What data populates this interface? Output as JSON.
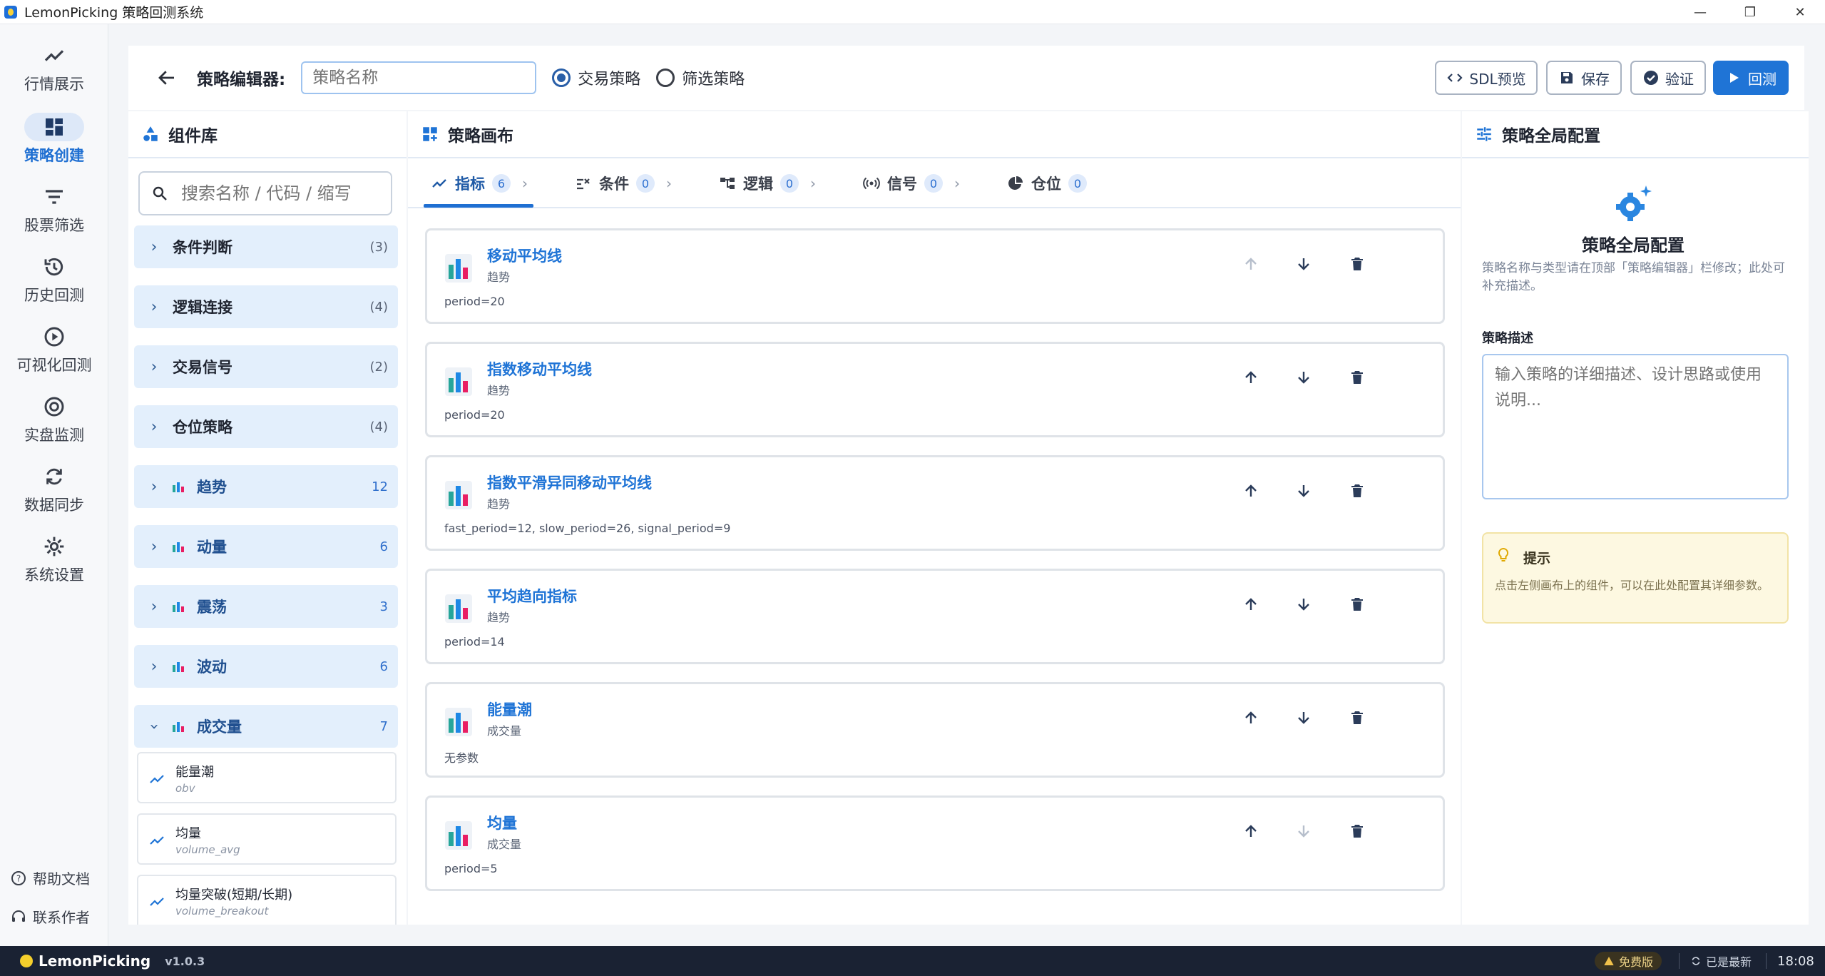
{
  "window": {
    "title": "LemonPicking 策略回测系统",
    "minimize": "—",
    "maximize": "❐",
    "close": "✕"
  },
  "nav": {
    "items": [
      {
        "label": "行情展示",
        "icon": "trend-icon"
      },
      {
        "label": "策略创建",
        "icon": "dashboard-icon",
        "active": true
      },
      {
        "label": "股票筛选",
        "icon": "filter-icon"
      },
      {
        "label": "历史回测",
        "icon": "history-icon"
      },
      {
        "label": "可视化回测",
        "icon": "play-circle-icon"
      },
      {
        "label": "实盘监测",
        "icon": "at-icon"
      },
      {
        "label": "数据同步",
        "icon": "sync-icon"
      },
      {
        "label": "系统设置",
        "icon": "gear-icon"
      }
    ],
    "help": "帮助文档",
    "contact": "联系作者"
  },
  "header": {
    "editor_label": "策略编辑器:",
    "name_placeholder": "策略名称",
    "radio_trade": "交易策略",
    "radio_filter": "筛选策略",
    "btn_sdl": "SDL预览",
    "btn_save": "保存",
    "btn_verify": "验证",
    "btn_backtest": "回测"
  },
  "library": {
    "title": "组件库",
    "search_placeholder": "搜索名称 / 代码 / 缩写",
    "categories": [
      {
        "name": "条件判断",
        "count": "(3)"
      },
      {
        "name": "逻辑连接",
        "count": "(4)"
      },
      {
        "name": "交易信号",
        "count": "(2)"
      },
      {
        "name": "仓位策略",
        "count": "(4)"
      },
      {
        "name": "趋势",
        "count": "12"
      },
      {
        "name": "动量",
        "count": "6"
      },
      {
        "name": "震荡",
        "count": "3"
      },
      {
        "name": "波动",
        "count": "6"
      },
      {
        "name": "成交量",
        "count": "7"
      }
    ],
    "sub_items": [
      {
        "name": "能量潮",
        "code": "obv"
      },
      {
        "name": "均量",
        "code": "volume_avg"
      },
      {
        "name": "均量突破(短期/长期)",
        "code": "volume_breakout"
      }
    ]
  },
  "canvas": {
    "title": "策略画布",
    "tabs": [
      {
        "label": "指标",
        "count": "6"
      },
      {
        "label": "条件",
        "count": "0"
      },
      {
        "label": "逻辑",
        "count": "0"
      },
      {
        "label": "信号",
        "count": "0"
      },
      {
        "label": "仓位",
        "count": "0"
      }
    ],
    "tab_arrow": "›",
    "indicators": [
      {
        "name": "移动平均线",
        "category": "趋势",
        "params": "period=20"
      },
      {
        "name": "指数移动平均线",
        "category": "趋势",
        "params": "period=20"
      },
      {
        "name": "指数平滑异同移动平均线",
        "category": "趋势",
        "params": "fast_period=12, slow_period=26, signal_period=9"
      },
      {
        "name": "平均趋向指标",
        "category": "趋势",
        "params": "period=14"
      },
      {
        "name": "能量潮",
        "category": "成交量",
        "params": "无参数"
      },
      {
        "name": "均量",
        "category": "成交量",
        "params": "period=5"
      }
    ]
  },
  "config": {
    "title": "策略全局配置",
    "heading": "策略全局配置",
    "description": "策略名称与类型请在顶部「策略编辑器」栏修改；此处可补充描述。",
    "desc_label": "策略描述",
    "desc_placeholder": "输入策略的详细描述、设计思路或使用说明...",
    "tip_title": "提示",
    "tip_text": "点击左侧画布上的组件，可以在此处配置其详细参数。"
  },
  "status": {
    "brand": "LemonPicking",
    "version": "v1.0.3",
    "free": "免费版",
    "latest": "已是最新",
    "time": "18:08"
  },
  "colors": {
    "accent": "#1f74d6",
    "nav_active_bg": "#dde8f8",
    "statusbar": "#1a2233",
    "tip_bg": "#fdf8e1"
  }
}
